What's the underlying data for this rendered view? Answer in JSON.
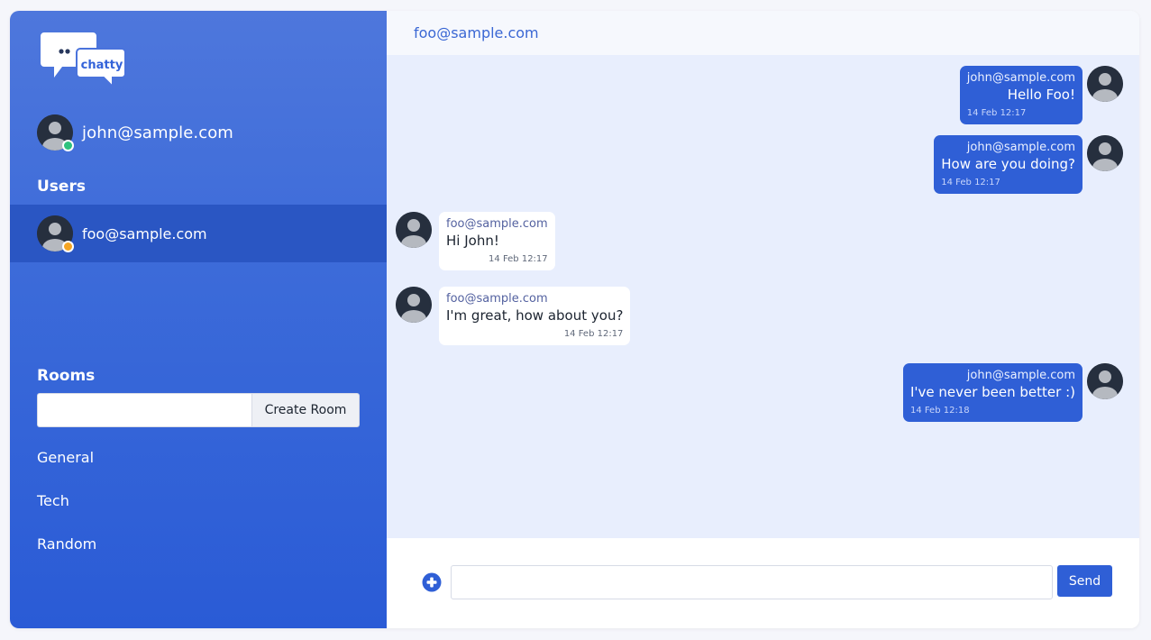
{
  "app": {
    "logo_text": "chatty"
  },
  "sidebar": {
    "current_user": {
      "email": "john@sample.com",
      "status": "online"
    },
    "users_title": "Users",
    "users": [
      {
        "email": "foo@sample.com",
        "status": "away"
      }
    ],
    "rooms_title": "Rooms",
    "room_input_placeholder": "",
    "create_room_label": "Create Room",
    "rooms": [
      {
        "name": "General"
      },
      {
        "name": "Tech"
      },
      {
        "name": "Random"
      }
    ]
  },
  "chat": {
    "header_title": "foo@sample.com",
    "messages": [
      {
        "from": "john@sample.com",
        "text": "Hello Foo!",
        "time": "14 Feb 12:17",
        "own": true
      },
      {
        "from": "john@sample.com",
        "text": "How are you doing?",
        "time": "14 Feb 12:17",
        "own": true
      },
      {
        "from": "foo@sample.com",
        "text": "Hi John!",
        "time": "14 Feb 12:17",
        "own": false
      },
      {
        "from": "foo@sample.com",
        "text": "I'm great, how about you?",
        "time": "14 Feb 12:17",
        "own": false
      },
      {
        "from": "john@sample.com",
        "text": "I've never been better :)",
        "time": "14 Feb 12:18",
        "own": true
      }
    ]
  },
  "composer": {
    "placeholder": "",
    "send_label": "Send",
    "attach_icon": "plus-circle-icon"
  },
  "colors": {
    "primary": "#2f5fd6",
    "sidebar_active": "#2a56c3",
    "online": "#2ec27e",
    "away": "#f5a524",
    "messages_bg": "#e8eefd"
  }
}
